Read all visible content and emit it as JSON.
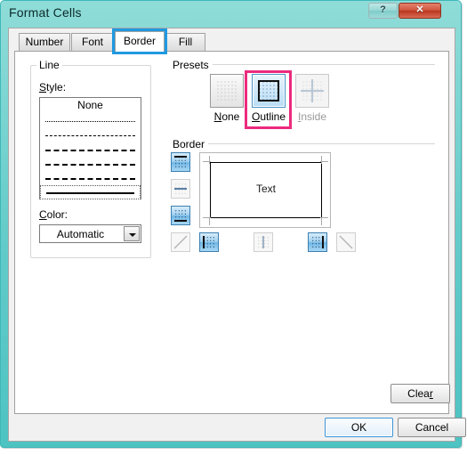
{
  "window": {
    "title": "Format Cells",
    "help_button": "?",
    "close_button": "✕",
    "frame_color": "#57c6c4",
    "accent_annotation_tab": "#1f99e0",
    "accent_annotation_preset": "#ec2a7e"
  },
  "tabs": [
    {
      "label": "Number",
      "selected": false
    },
    {
      "label": "Font",
      "selected": false
    },
    {
      "label": "Border",
      "selected": true
    },
    {
      "label": "Fill",
      "selected": false
    }
  ],
  "line_group": {
    "title": "Line",
    "style_label": "Style:",
    "style_label_mnemonic": "S",
    "styles": [
      {
        "name": "none",
        "label": "None",
        "selected": false
      },
      {
        "name": "dotted",
        "label": "",
        "selected": false
      },
      {
        "name": "dashed-fine",
        "label": "",
        "selected": false
      },
      {
        "name": "dash-dot",
        "label": "",
        "selected": false
      },
      {
        "name": "dash-dot-dot",
        "label": "",
        "selected": false
      },
      {
        "name": "dashed",
        "label": "",
        "selected": false
      },
      {
        "name": "solid-thin",
        "label": "",
        "selected": true
      }
    ],
    "color_label": "Color:",
    "color_label_mnemonic": "C",
    "color_value": "Automatic",
    "color_dropdown_icon": "chevron-down-icon"
  },
  "presets_group": {
    "title": "Presets",
    "items": [
      {
        "name": "none",
        "label": "None",
        "mnemonic": "N",
        "state": "normal",
        "icon": "preset-none-icon"
      },
      {
        "name": "outline",
        "label": "Outline",
        "mnemonic": "O",
        "state": "pressed",
        "icon": "preset-outline-icon"
      },
      {
        "name": "inside",
        "label": "Inside",
        "mnemonic": "I",
        "state": "disabled",
        "icon": "preset-inside-icon"
      }
    ]
  },
  "border_group": {
    "title": "Border",
    "buttons": [
      {
        "name": "top-border",
        "icon": "border-top-icon",
        "state": "on"
      },
      {
        "name": "horizontal-inside",
        "icon": "border-horizontal-icon",
        "state": "off"
      },
      {
        "name": "bottom-border",
        "icon": "border-bottom-icon",
        "state": "on"
      },
      {
        "name": "diagonal-up-border",
        "icon": "border-diagonal-up-icon",
        "state": "off"
      },
      {
        "name": "left-border",
        "icon": "border-left-icon",
        "state": "on"
      },
      {
        "name": "vertical-inside",
        "icon": "border-vertical-icon",
        "state": "off"
      },
      {
        "name": "right-border",
        "icon": "border-right-icon",
        "state": "on"
      },
      {
        "name": "diagonal-down-border",
        "icon": "border-diagonal-down-icon",
        "state": "off"
      }
    ],
    "preview_text": "Text",
    "preview_edges": {
      "top": true,
      "bottom": true,
      "left": true,
      "right": true
    }
  },
  "actions": {
    "clear_label": "Clear",
    "clear_mnemonic": "r",
    "ok_label": "OK",
    "cancel_label": "Cancel"
  }
}
